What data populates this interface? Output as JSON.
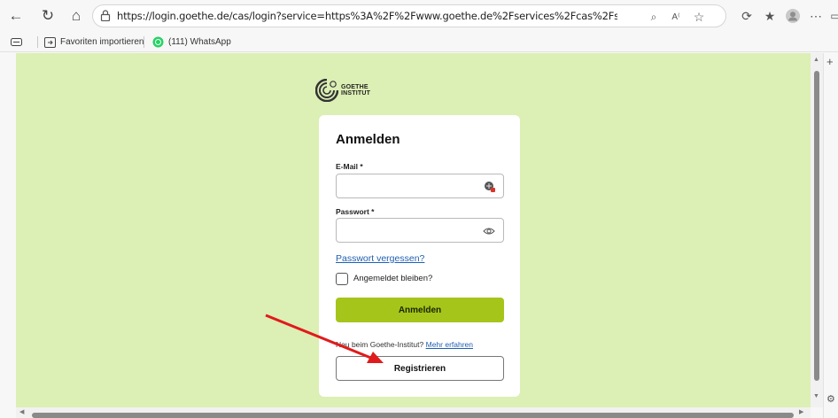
{
  "browser": {
    "url": "https://login.goethe.de/cas/login?service=https%3A%2F%2Fwww.goethe.de%2Fservices%2Fcas%2Fservice%2Fgoethe%2F&locale=d...",
    "icons": [
      "back-icon",
      "refresh-icon",
      "home-icon",
      "lock-icon",
      "zoom-icon",
      "read-aloud-icon",
      "favorite-icon",
      "extensions-icon",
      "favorites-icon",
      "profile-icon",
      "more-icon"
    ]
  },
  "bookmarks": {
    "import_label": "Favoriten importieren",
    "whatsapp_label": "(111) WhatsApp"
  },
  "logo": {
    "line1": "GOETHE",
    "line2": "INSTITUT"
  },
  "form": {
    "title": "Anmelden",
    "email_label": "E-Mail *",
    "email_value": "",
    "password_label": "Passwort *",
    "password_value": "",
    "forgot_label": "Passwort vergessen?",
    "remember_label": "Angemeldet bleiben?",
    "remember_checked": false,
    "login_button": "Anmelden",
    "new_prefix": "Neu beim Goethe-Institut?",
    "new_link": "Mehr erfahren",
    "register_button": "Registrieren"
  },
  "colors": {
    "page_bg": "#dcefb4",
    "accent": "#a5c51a",
    "link": "#1f5fb3",
    "arrow": "#e01b1b"
  }
}
